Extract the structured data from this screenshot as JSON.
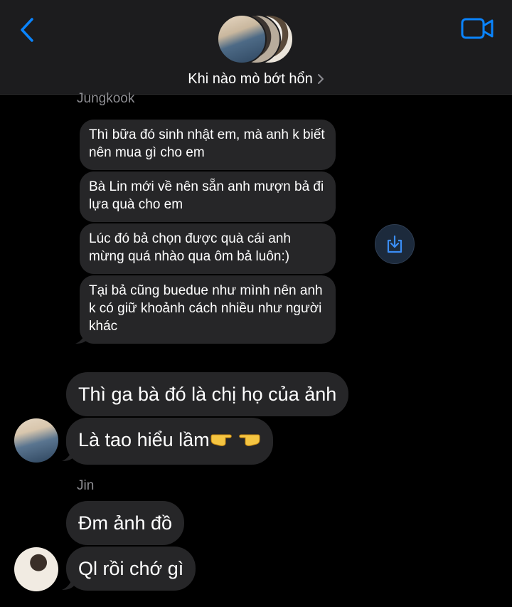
{
  "header": {
    "title": "Khi nào mò bớt hổn",
    "back_icon": "chevron-left-icon",
    "video_icon": "video-camera-icon",
    "accent": "#0a84ff"
  },
  "thread": {
    "sender_jungkook": "Jungkook",
    "sender_jin": "Jin",
    "shared_messages": [
      "Thì bữa đó sinh nhật em, mà anh k biết nên mua gì cho em",
      "Bà Lin mới về nên sẵn anh mượn bả đi lựa quà cho em",
      "Lúc đó bả chọn được quà cái anh mừng quá nhào qua ôm bả luôn:)",
      "Tại bả cũng buedue như mình nên anh k có giữ khoảnh cách nhiều như người khác"
    ],
    "jungkook_messages": [
      "Thì ga bà đó là chị họ của ảnh",
      "Là tao hiểu lầm"
    ],
    "jin_messages": [
      "Đm ảnh đồ",
      "Ql rồi chớ gì"
    ],
    "share_icon": "share-tray-icon",
    "bubble_color": "#262628"
  }
}
